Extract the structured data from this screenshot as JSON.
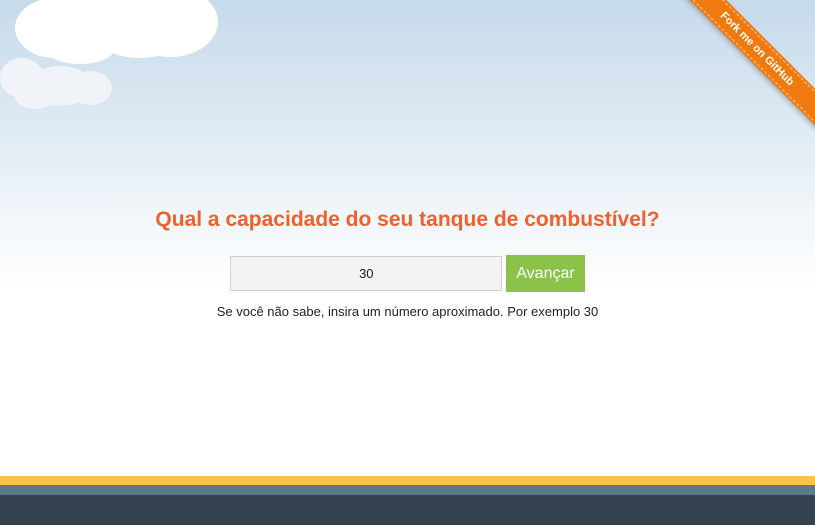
{
  "ribbon": {
    "label": "Fork me on GitHub",
    "color": "#f07a10"
  },
  "question": {
    "title": "Qual a capacidade do seu tanque de combustível?",
    "color": "#f1602c"
  },
  "form": {
    "capacity_value": "30",
    "next_label": "Avançar",
    "button_color": "#8bc34a"
  },
  "hint": {
    "text": "Se você não sabe, insira um número aproximado. Por exemplo 30"
  },
  "footer": {
    "stripe_colors": [
      "#f8c545",
      "#5e7988",
      "#34434f"
    ]
  }
}
